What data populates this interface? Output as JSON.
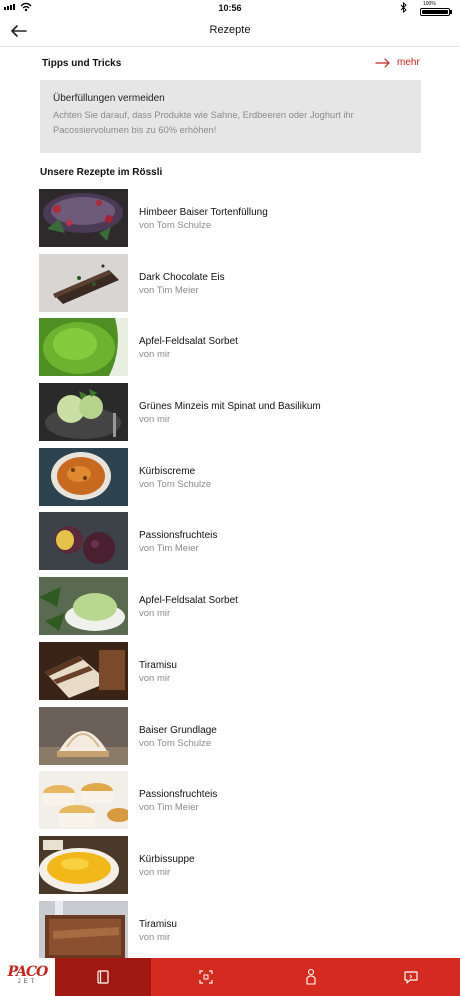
{
  "status": {
    "time": "10:56",
    "battery": "100%"
  },
  "nav": {
    "title": "Rezepte",
    "back_icon": "arrow-left-icon"
  },
  "tips": {
    "heading": "Tipps und Tricks",
    "more_label": "mehr",
    "card": {
      "title": "Überfüllungen vermeiden",
      "body_line1": "Achten Sie darauf, dass Produkte wie Sahne, Erdbeeren oder Joghurt ihr",
      "body_line2": "Pacossiervolumen bis zu 60% erhöhen!"
    }
  },
  "recipes_heading": "Unsere Rezepte im Rössli",
  "recipes": [
    {
      "title": "Himbeer Baiser Tortenfüllung",
      "author": "von Tom Schulze"
    },
    {
      "title": "Dark Chocolate Eis",
      "author": "von Tim Meier"
    },
    {
      "title": "Apfel-Feldsalat Sorbet",
      "author": "von mir"
    },
    {
      "title": "Grünes Minzeis mit Spinat  und Basilikum",
      "author": "von mir"
    },
    {
      "title": "Kürbiscreme",
      "author": "von Tom Schulze"
    },
    {
      "title": "Passionsfruchteis",
      "author": "von Tim Meier"
    },
    {
      "title": "Apfel-Feldsalat Sorbet",
      "author": "von mir"
    },
    {
      "title": "Tiramisu",
      "author": "von mir"
    },
    {
      "title": "Baiser Grundlage",
      "author": "von Tom Schulze"
    },
    {
      "title": "Passionsfruchteis",
      "author": "von Tim Meier"
    },
    {
      "title": "Kürbissuppe",
      "author": "von mir"
    },
    {
      "title": "Tiramisu",
      "author": "von mir"
    }
  ],
  "tabbar": {
    "logo_text": "PACO",
    "logo_sub": "JET",
    "items": [
      "book-icon",
      "scan-icon",
      "chef-icon",
      "chat-icon"
    ],
    "active": 0
  },
  "colors": {
    "accent": "#d42a20",
    "accent_dark": "#a11810",
    "tip_bg": "#e6e6e6",
    "muted": "#8a8a8a"
  }
}
